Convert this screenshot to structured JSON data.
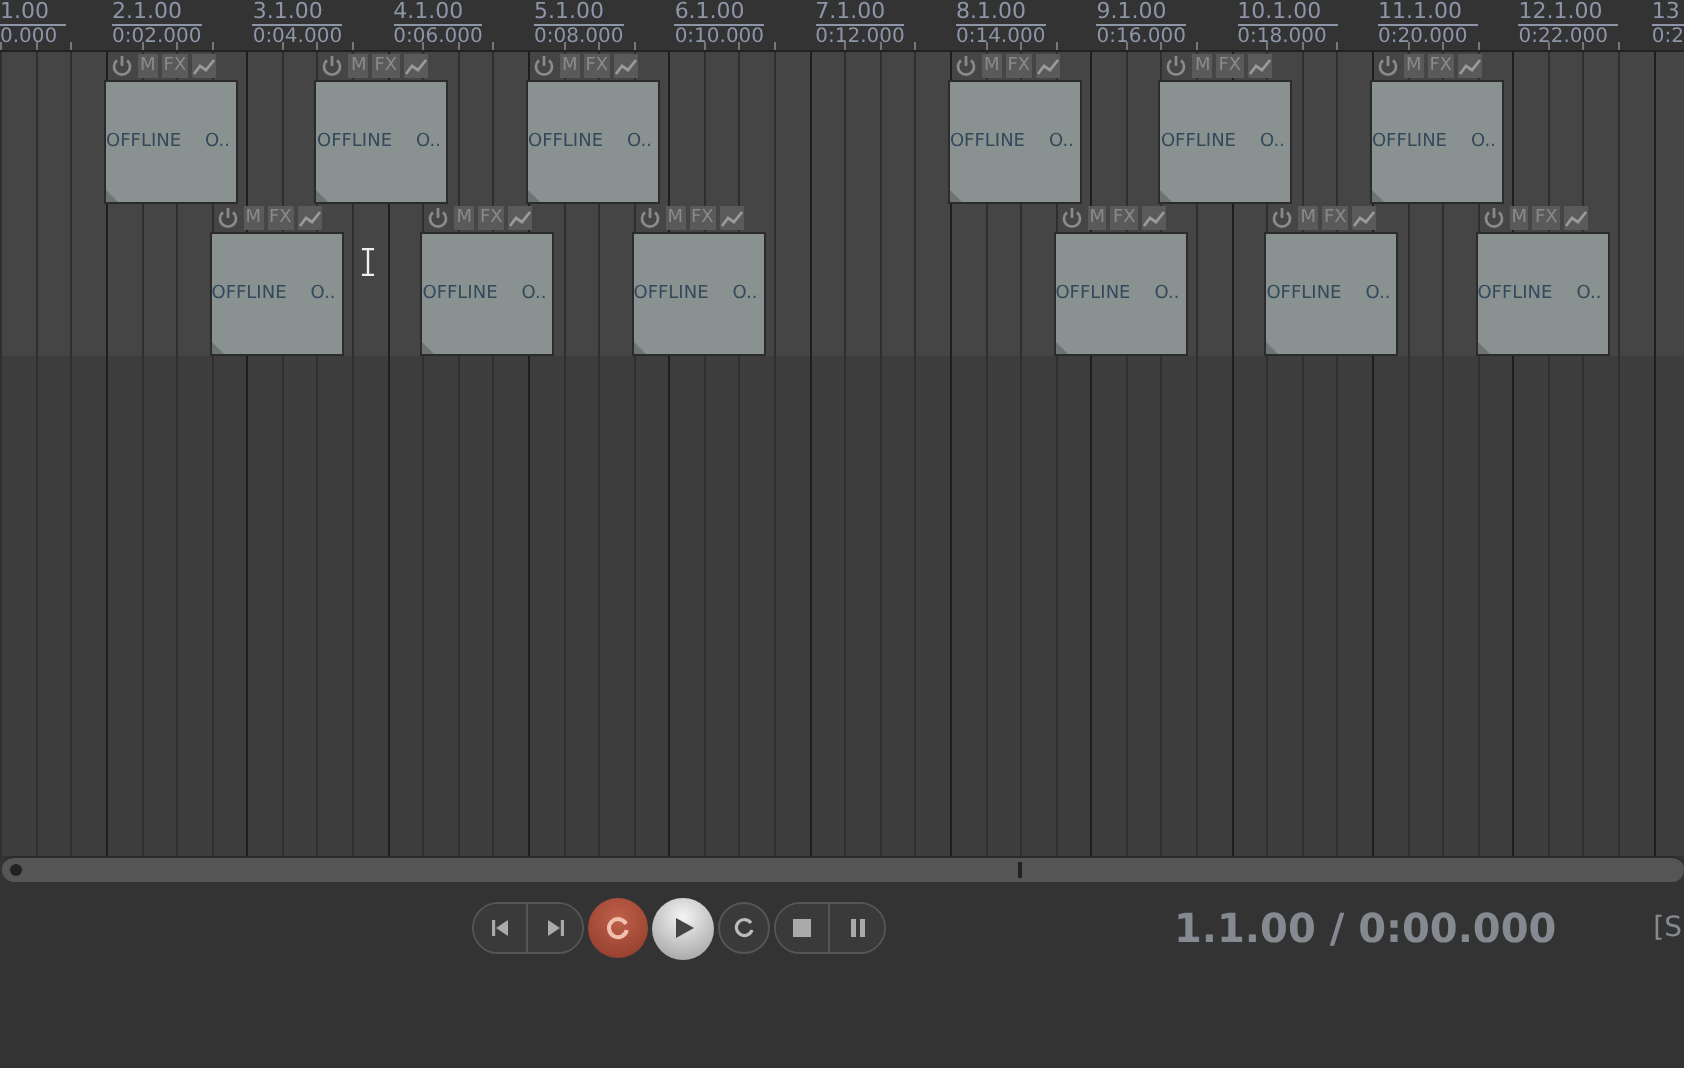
{
  "ruler": {
    "markers": [
      {
        "bar": "1.00",
        "time": "0.000"
      },
      {
        "bar": "2.1.00",
        "time": "0:02.000"
      },
      {
        "bar": "3.1.00",
        "time": "0:04.000"
      },
      {
        "bar": "4.1.00",
        "time": "0:06.000"
      },
      {
        "bar": "5.1.00",
        "time": "0:08.000"
      },
      {
        "bar": "6.1.00",
        "time": "0:10.000"
      },
      {
        "bar": "7.1.00",
        "time": "0:12.000"
      },
      {
        "bar": "8.1.00",
        "time": "0:14.000"
      },
      {
        "bar": "9.1.00",
        "time": "0:16.000"
      },
      {
        "bar": "10.1.00",
        "time": "0:18.000"
      },
      {
        "bar": "11.1.00",
        "time": "0:20.000"
      },
      {
        "bar": "12.1.00",
        "time": "0:22.000"
      },
      {
        "bar": "13",
        "time": "0:2"
      }
    ]
  },
  "tracks": [
    {
      "items": [
        {
          "mute": "M",
          "fx": "FX",
          "status": "OFFLINE",
          "name": "O.."
        },
        {
          "mute": "M",
          "fx": "FX",
          "status": "OFFLINE",
          "name": "O.."
        },
        {
          "mute": "M",
          "fx": "FX",
          "status": "OFFLINE",
          "name": "O.."
        },
        {
          "mute": "M",
          "fx": "FX",
          "status": "OFFLINE",
          "name": "O.."
        },
        {
          "mute": "M",
          "fx": "FX",
          "status": "OFFLINE",
          "name": "O.."
        },
        {
          "mute": "M",
          "fx": "FX",
          "status": "OFFLINE",
          "name": "O.."
        }
      ]
    },
    {
      "items": [
        {
          "mute": "M",
          "fx": "FX",
          "status": "OFFLINE",
          "name": "O.."
        },
        {
          "mute": "M",
          "fx": "FX",
          "status": "OFFLINE",
          "name": "O.."
        },
        {
          "mute": "M",
          "fx": "FX",
          "status": "OFFLINE",
          "name": "O.."
        },
        {
          "mute": "M",
          "fx": "FX",
          "status": "OFFLINE",
          "name": "O.."
        },
        {
          "mute": "M",
          "fx": "FX",
          "status": "OFFLINE",
          "name": "O.."
        },
        {
          "mute": "M",
          "fx": "FX",
          "status": "OFFLINE",
          "name": "O.."
        }
      ]
    }
  ],
  "transport": {
    "time": "1.1.00 / 0:00.000",
    "status": "[S"
  }
}
